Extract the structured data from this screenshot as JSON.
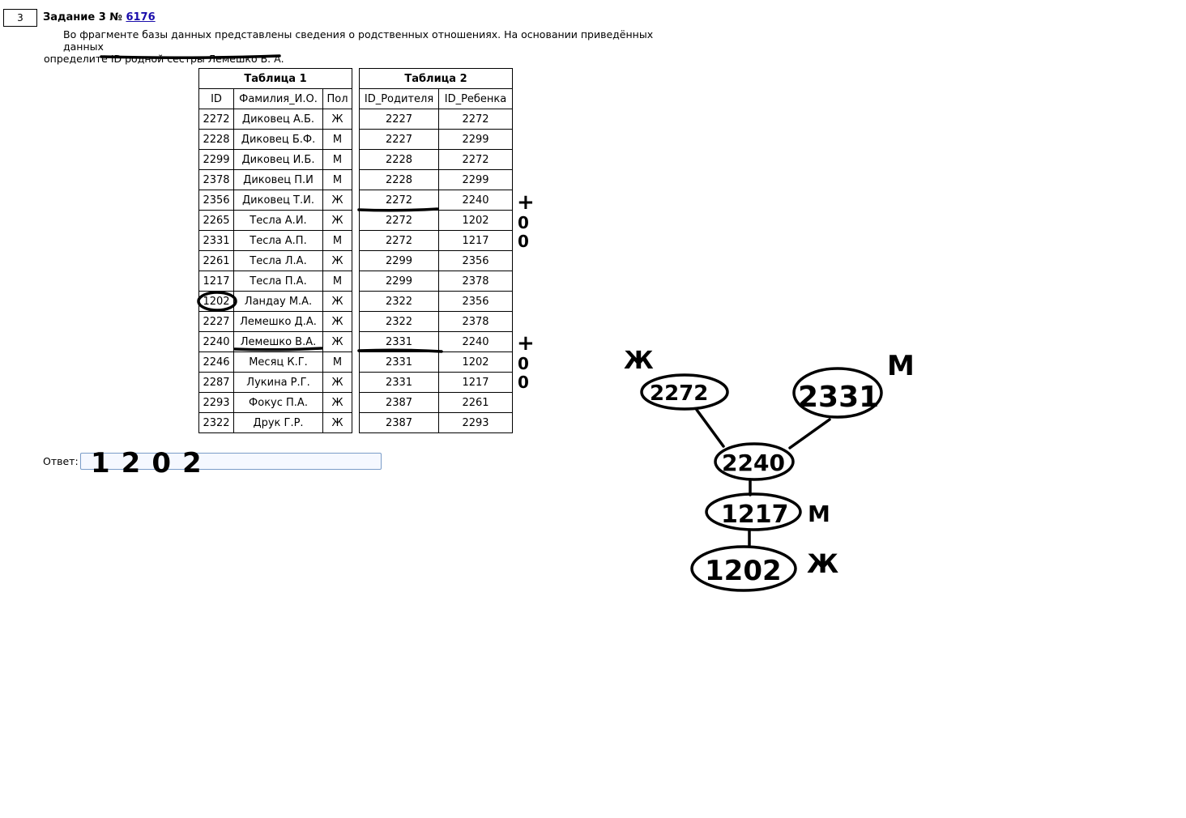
{
  "task": {
    "number_box": "3",
    "title_prefix": "Задание 3 №",
    "id_link": "6176",
    "text_line1": "Во фрагменте базы данных представлены сведения о родственных отношениях. На основании приведённых данных",
    "text_line2": "определите ID родной сестры Лемешко В. А."
  },
  "table1": {
    "title": "Таблица 1",
    "headers": [
      "ID",
      "Фамилия_И.О.",
      "Пол"
    ],
    "rows": [
      [
        "2272",
        "Диковец А.Б.",
        "Ж"
      ],
      [
        "2228",
        "Диковец Б.Ф.",
        "М"
      ],
      [
        "2299",
        "Диковец И.Б.",
        "М"
      ],
      [
        "2378",
        "Диковец П.И",
        "М"
      ],
      [
        "2356",
        "Диковец Т.И.",
        "Ж"
      ],
      [
        "2265",
        "Тесла А.И.",
        "Ж"
      ],
      [
        "2331",
        "Тесла А.П.",
        "М"
      ],
      [
        "2261",
        "Тесла Л.А.",
        "Ж"
      ],
      [
        "1217",
        "Тесла П.А.",
        "М"
      ],
      [
        "1202",
        "Ландау М.А.",
        "Ж"
      ],
      [
        "2227",
        "Лемешко Д.А.",
        "Ж"
      ],
      [
        "2240",
        "Лемешко В.А.",
        "Ж"
      ],
      [
        "2246",
        "Месяц К.Г.",
        "М"
      ],
      [
        "2287",
        "Лукина Р.Г.",
        "Ж"
      ],
      [
        "2293",
        "Фокус П.А.",
        "Ж"
      ],
      [
        "2322",
        "Друк Г.Р.",
        "Ж"
      ]
    ]
  },
  "table2": {
    "title": "Таблица 2",
    "headers": [
      "ID_Родителя",
      "ID_Ребенка"
    ],
    "rows": [
      [
        "2227",
        "2272"
      ],
      [
        "2227",
        "2299"
      ],
      [
        "2228",
        "2272"
      ],
      [
        "2228",
        "2299"
      ],
      [
        "2272",
        "2240"
      ],
      [
        "2272",
        "1202"
      ],
      [
        "2272",
        "1217"
      ],
      [
        "2299",
        "2356"
      ],
      [
        "2299",
        "2378"
      ],
      [
        "2322",
        "2356"
      ],
      [
        "2322",
        "2378"
      ],
      [
        "2331",
        "2240"
      ],
      [
        "2331",
        "1202"
      ],
      [
        "2331",
        "1217"
      ],
      [
        "2387",
        "2261"
      ],
      [
        "2387",
        "2293"
      ]
    ]
  },
  "answer": {
    "label": "Ответ:",
    "handwritten_value": "1202"
  },
  "handwriting": {
    "marks_plus": "+",
    "marks_zero": "0",
    "tree_nodes": [
      "2272",
      "2331",
      "2240",
      "1217",
      "1202"
    ],
    "tree_labels": [
      "Ж",
      "М",
      "М",
      "Ж"
    ]
  }
}
